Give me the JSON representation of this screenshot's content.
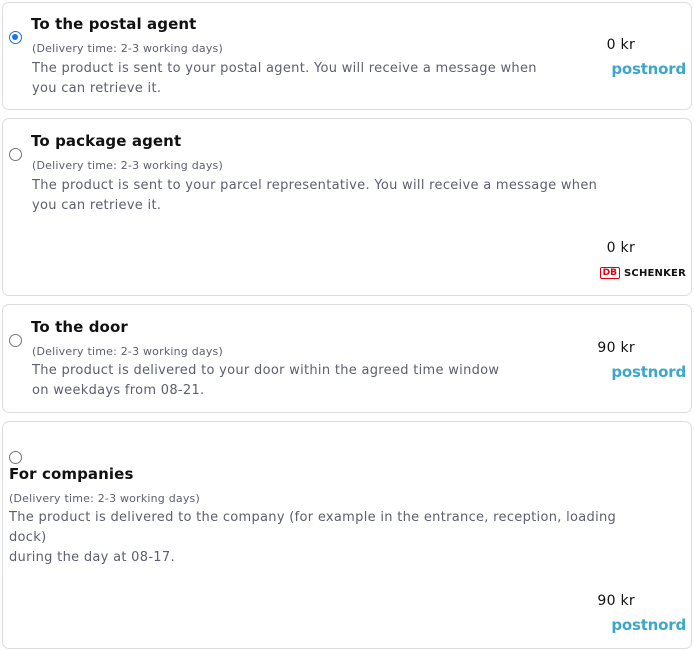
{
  "options": [
    {
      "title": "To the postal agent",
      "delivery_time": "(Delivery time: 2-3 working days)",
      "description": [
        "The product is sent to your postal agent. You will receive a message when",
        "you can retrieve it."
      ],
      "price": "0 kr",
      "carrier": "postnord",
      "selected": true
    },
    {
      "title": "To package agent",
      "delivery_time": "(Delivery time: 2-3 working days)",
      "description": [
        "The product is sent to your parcel representative. You will receive a message when",
        "you can retrieve it."
      ],
      "price": "0 kr",
      "carrier_badge": "DB",
      "carrier": "SCHENKER",
      "selected": false
    },
    {
      "title": "To the door",
      "delivery_time": "(Delivery time: 2-3 working days)",
      "description": [
        "The product is delivered to your door within the agreed time window",
        "on weekdays from 08-21."
      ],
      "price": "90 kr",
      "carrier": "postnord",
      "selected": false
    },
    {
      "title": "For companies",
      "delivery_time": "(Delivery time: 2-3 working days)",
      "description": [
        "The product is delivered to the company (for example in the entrance, reception, loading",
        "dock)",
        "during the day at 08-17."
      ],
      "price": "90 kr",
      "carrier": "postnord",
      "selected": false
    }
  ],
  "colors": {
    "accent": "#1a73e8",
    "postnord": "#3ca7c9",
    "db_red": "#e3000f",
    "border": "#dcdde3"
  }
}
